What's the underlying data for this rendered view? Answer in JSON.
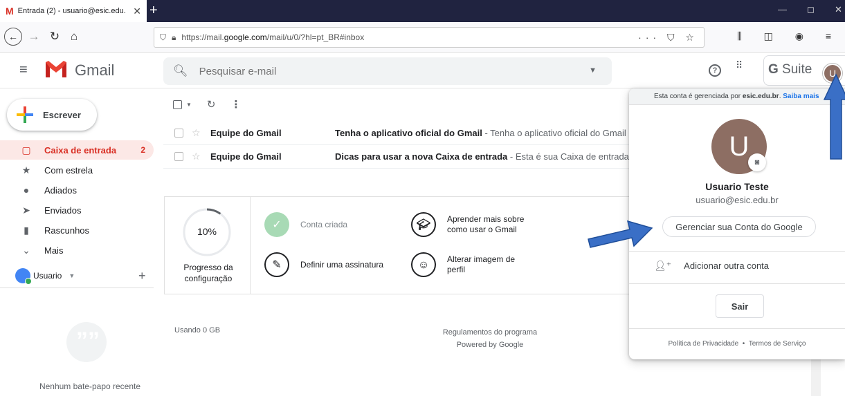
{
  "browser": {
    "tab_title": "Entrada (2) - usuario@esic.edu.",
    "tab_close": "✕",
    "new_tab": "+",
    "url_prefix": "https://mail.",
    "url_domain": "google.com",
    "url_suffix": "/mail/u/0/?hl=pt_BR#inbox",
    "url_actions": "··· ⛉ ☆",
    "toolbar_icons": "⫼ ◫ ◉ ≡"
  },
  "header": {
    "app_name": "Gmail",
    "search_placeholder": "Pesquisar e-mail",
    "gsuite_g": "G",
    "gsuite_label": " Suite",
    "avatar_letter": "U"
  },
  "sidebar": {
    "compose_label": "Escrever",
    "items": [
      {
        "label": "Caixa de entrada",
        "icon": "inbox-icon",
        "count": "2"
      },
      {
        "label": "Com estrela",
        "icon": "star-icon"
      },
      {
        "label": "Adiados",
        "icon": "clock-icon"
      },
      {
        "label": "Enviados",
        "icon": "send-icon"
      },
      {
        "label": "Rascunhos",
        "icon": "draft-icon"
      },
      {
        "label": "Mais",
        "icon": "chevron-down-icon"
      }
    ],
    "user_name": "Usuario",
    "no_chat": "Nenhum bate-papo recente"
  },
  "mail": {
    "rows": [
      {
        "sender": "Equipe do Gmail",
        "subject": "Tenha o aplicativo oficial do Gmail",
        "snippet": " - Tenha o aplicativo oficial do Gmail O"
      },
      {
        "sender": "Equipe do Gmail",
        "subject": "Dicas para usar a nova Caixa de entrada",
        "snippet": " - Esta é sua Caixa de entrada Enc"
      }
    ]
  },
  "setup": {
    "progress_percent": "10%",
    "progress_value": 0.1,
    "progress_label": "Progresso da configuração",
    "items": [
      {
        "label": "Conta criada",
        "done": true
      },
      {
        "label": "Aprender mais sobre como usar o Gmail",
        "done": false
      },
      {
        "label": "Definir uma assinatura",
        "done": false
      },
      {
        "label": "Alterar imagem de perfil",
        "done": false
      }
    ]
  },
  "footer": {
    "storage": "Usando 0 GB",
    "terms": "Regulamentos do programa",
    "powered": "Powered by Google"
  },
  "account_popup": {
    "managed_text": "Esta conta é gerenciada por ",
    "managed_domain": "esic.edu.br",
    "managed_sep": ". ",
    "learn_more": "Saiba mais",
    "avatar_letter": "U",
    "name": "Usuario Teste",
    "email": "usuario@esic.edu.br",
    "manage_button": "Gerenciar sua Conta do Google",
    "add_account": "Adicionar outra conta",
    "sign_out": "Sair",
    "privacy": "Política de Privacidade",
    "footer_sep": "•",
    "terms": "Termos de Serviço"
  },
  "colors": {
    "accent_red": "#d93025",
    "arrow_blue": "#3a6fc6"
  }
}
